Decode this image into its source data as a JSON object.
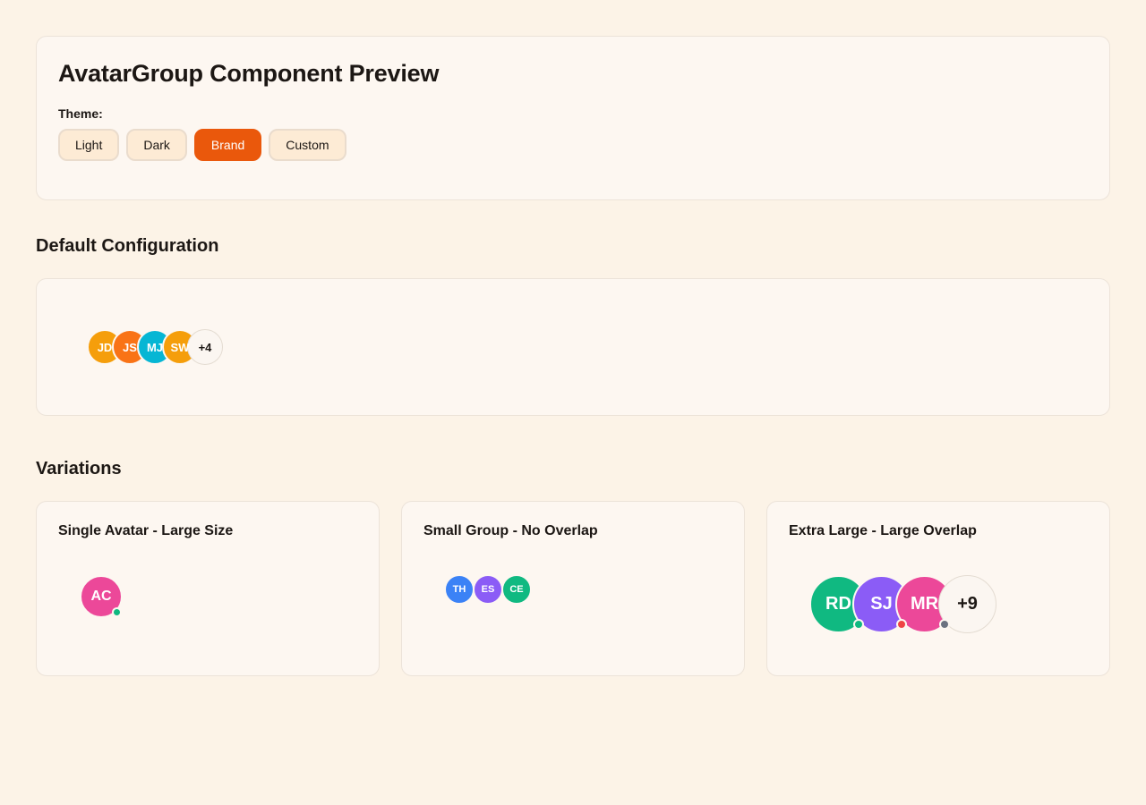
{
  "header": {
    "title": "AvatarGroup Component Preview",
    "theme_label": "Theme:",
    "themes": [
      {
        "label": "Light",
        "active": false
      },
      {
        "label": "Dark",
        "active": false
      },
      {
        "label": "Brand",
        "active": true
      },
      {
        "label": "Custom",
        "active": false
      }
    ]
  },
  "default_section": {
    "title": "Default Configuration",
    "avatars": [
      {
        "initials": "JD",
        "color": "#f59e0b"
      },
      {
        "initials": "JS",
        "color": "#f97316"
      },
      {
        "initials": "MJ",
        "color": "#06b6d4"
      },
      {
        "initials": "SW",
        "color": "#f59e0b"
      }
    ],
    "overflow": "+4"
  },
  "variations": {
    "title": "Variations",
    "single": {
      "title": "Single Avatar - Large Size",
      "avatar": {
        "initials": "AC",
        "color": "#ec4899",
        "status_color": "#10b981"
      }
    },
    "small": {
      "title": "Small Group - No Overlap",
      "avatars": [
        {
          "initials": "TH",
          "color": "#3b82f6"
        },
        {
          "initials": "ES",
          "color": "#8b5cf6"
        },
        {
          "initials": "CE",
          "color": "#10b981"
        }
      ]
    },
    "xl": {
      "title": "Extra Large - Large Overlap",
      "avatars": [
        {
          "initials": "RD",
          "color": "#10b981",
          "status_color": "#10b981"
        },
        {
          "initials": "SJ",
          "color": "#8b5cf6",
          "status_color": "#ef4444"
        },
        {
          "initials": "MR",
          "color": "#ec4899",
          "status_color": "#6b7280"
        }
      ],
      "overflow": "+9"
    }
  }
}
